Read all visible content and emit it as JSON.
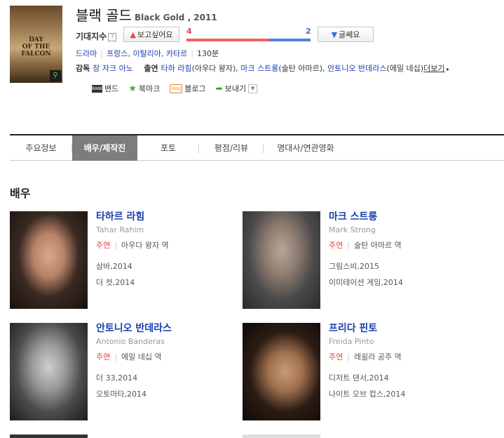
{
  "poster": {
    "title_line1": "DAY",
    "title_line2": "OF THE",
    "title_line3": "FALCON"
  },
  "movie": {
    "title_ko": "블랙 골드",
    "title_en": "Black Gold , 2011"
  },
  "expect": {
    "label": "기대지수",
    "help": "?",
    "like_label": "보고싶어요",
    "dislike_label": "글쎄요",
    "like_count": "4",
    "dislike_count": "2",
    "like_ratio": 0.667
  },
  "meta": {
    "genre": "드라마",
    "countries": "프랑스, 이탈리아, 카타르",
    "runtime": "130분",
    "director_label": "감독",
    "director": "장 자크 아노",
    "cast_label": "출연",
    "cast": [
      {
        "name": "타하 라힘",
        "role": "(아우다 왕자), "
      },
      {
        "name": "마크 스트롱",
        "role": "(술탄 아마르), "
      },
      {
        "name": "안토니오 반데라스",
        "role": "(에밀 네십)"
      }
    ],
    "more": "더보기"
  },
  "share": {
    "band": "밴드",
    "bookmark": "북마크",
    "blog": "블로그",
    "send": "보내기"
  },
  "tabs": [
    "주요정보",
    "배우/제작진",
    "포토",
    "평점/리뷰",
    "명대사/연관영화"
  ],
  "section_title": "배우",
  "actors": [
    {
      "name": "타하르 라힘",
      "ename": "Tahar Rahim",
      "lead": "주연",
      "role": "아우다 왕자 역",
      "films": [
        "삼바,2014",
        "더 컷,2014"
      ]
    },
    {
      "name": "마크 스트롱",
      "ename": "Mark Strong",
      "lead": "주연",
      "role": "술탄 아마르 역",
      "films": [
        "그림스비,2015",
        "이미테이션 게임,2014"
      ]
    },
    {
      "name": "안토니오 반데라스",
      "ename": "Antonio Banderas",
      "lead": "주연",
      "role": "에밀 네십 역",
      "films": [
        "더 33,2014",
        "오토마타,2014"
      ]
    },
    {
      "name": "프리다 핀토",
      "ename": "Freida Pinto",
      "lead": "주연",
      "role": "레쉴라 공주 역",
      "films": [
        "디저트 댄서,2014",
        "나이트 오브 컵스,2014"
      ]
    }
  ],
  "colors": {
    "link": "#1a3dae",
    "like": "#e84545",
    "dislike": "#3c6fd6",
    "tab_active": "#7d7d7d"
  }
}
